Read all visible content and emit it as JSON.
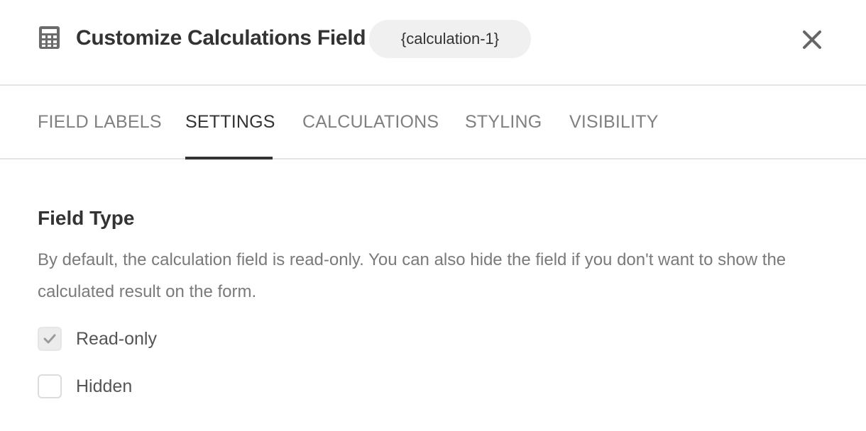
{
  "header": {
    "icon": "calculator-icon",
    "title": "Customize Calculations Field",
    "tag": "{calculation-1}",
    "close_icon": "close-icon"
  },
  "tabs": [
    {
      "label": "FIELD LABELS",
      "active": false
    },
    {
      "label": "SETTINGS",
      "active": true
    },
    {
      "label": "CALCULATIONS",
      "active": false
    },
    {
      "label": "STYLING",
      "active": false
    },
    {
      "label": "VISIBILITY",
      "active": false
    }
  ],
  "field_type": {
    "title": "Field Type",
    "description": "By default, the calculation field is read-only. You can also hide the field if you don't want to show the calculated result on the form.",
    "options": [
      {
        "label": "Read-only",
        "checked": true
      },
      {
        "label": "Hidden",
        "checked": false
      }
    ]
  },
  "colors": {
    "text_primary": "#333333",
    "text_muted": "#808080",
    "border": "#e4e4e4",
    "pill_bg": "#f0f0f0"
  }
}
